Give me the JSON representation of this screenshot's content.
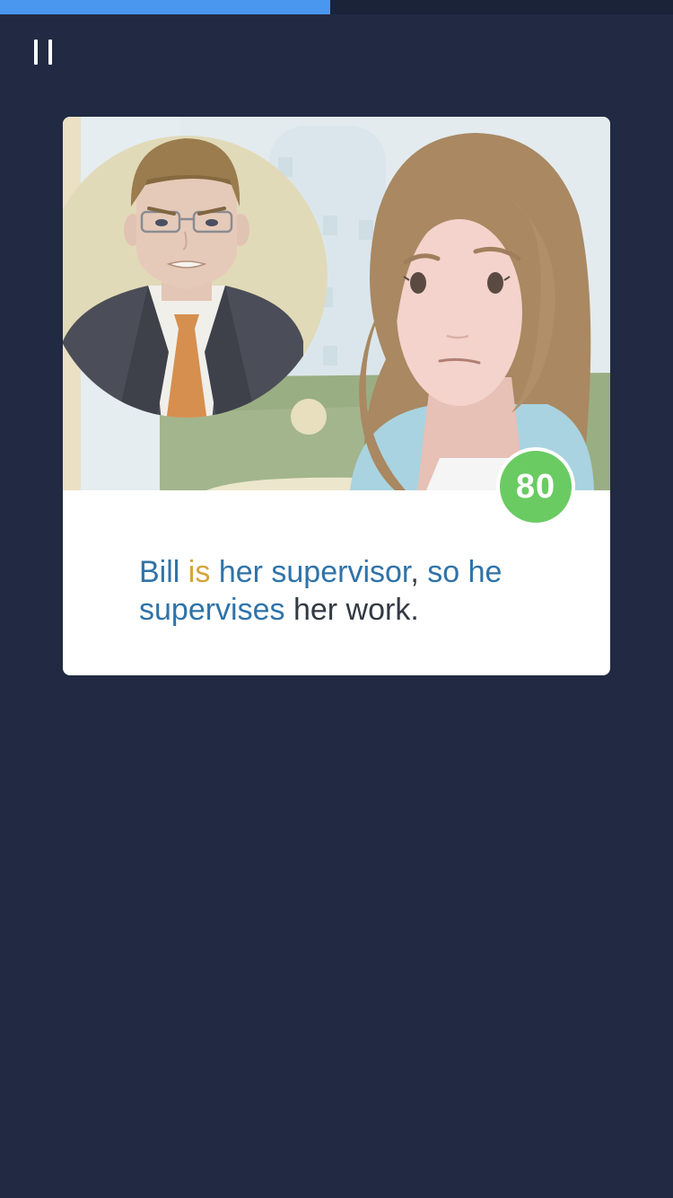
{
  "progress": {
    "fraction": 0.49
  },
  "controls": {
    "pause_icon": "pause-icon"
  },
  "card": {
    "score": "80",
    "score_color": "#6acb63",
    "illustration_icon": "supervisor-and-employee-illustration",
    "sentence": {
      "words": [
        {
          "text": "Bill",
          "style": "blue"
        },
        {
          "text": " ",
          "style": "dark"
        },
        {
          "text": "is",
          "style": "gold"
        },
        {
          "text": " ",
          "style": "dark"
        },
        {
          "text": "her supervisor",
          "style": "blue"
        },
        {
          "text": ", ",
          "style": "dark"
        },
        {
          "text": "so he",
          "style": "blue"
        },
        {
          "text": " ",
          "style": "dark"
        },
        {
          "text": "supervises",
          "style": "blue"
        },
        {
          "text": " her work.",
          "style": "dark"
        }
      ]
    }
  },
  "colors": {
    "background": "#212a42",
    "progress_fill": "#4a97f0",
    "word_blue": "#2f73a8",
    "word_gold": "#d5a43a",
    "text_dark": "#333a44"
  }
}
